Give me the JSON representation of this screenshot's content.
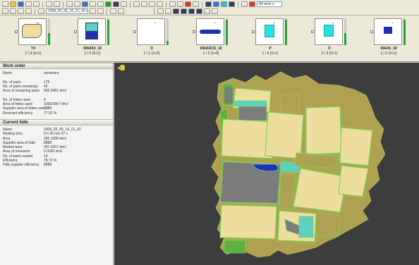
{
  "toolbar": {
    "file_combo": "2008_03_06_16_21_42.nb",
    "work_combo": "All work o"
  },
  "colors": {
    "hide": "#aea252",
    "part": "#eddea0",
    "part_edge": "#7ed35a",
    "green_part": "#5fb13f",
    "grey_part": "#7c7c7c",
    "cyan": "#5fd0c0",
    "blue_part": "#1d33b5",
    "canvas_bg": "#3d3d3d"
  },
  "thumbnails": [
    {
      "num": "76",
      "name": "T4",
      "count": "1 / 4 (0+1)",
      "shape": "cream-blob",
      "fill": 0.45
    },
    {
      "num": "30",
      "name": "666A53_18",
      "count": "1 / 2 (0+1)",
      "shape": "cyan-blue-box",
      "fill": 0.95
    },
    {
      "num": "1",
      "name": "D",
      "count": "1 / 1 (1+0)",
      "shape": "empty",
      "fill": 0.15
    },
    {
      "num": "1",
      "name": "666ADCS_18",
      "count": "1 / 2 (1+0)",
      "shape": "blue-bar",
      "fill": 0.95
    },
    {
      "num": "2",
      "name": "P",
      "count": "1 / 4 (0+1)",
      "shape": "cyan-box",
      "fill": 0.95
    },
    {
      "num": "1",
      "name": "O",
      "count": "2 / 4 (0+1)",
      "shape": "cyan-box-small",
      "fill": 0.45
    },
    {
      "num": "1",
      "name": "666A5_18",
      "count": "1 / 2 (0+1)",
      "shape": "blue-square",
      "fill": 0.95
    }
  ],
  "work_order": {
    "title": "Work order",
    "rows": [
      {
        "k": "Name",
        "v": "seminaire"
      },
      {
        "k": "",
        "v": ""
      },
      {
        "k": "No. of parts",
        "v": "175"
      },
      {
        "k": "No. of parts remaining",
        "v": "45"
      },
      {
        "k": "Area of remaining parts",
        "v": "583.0481 dm2"
      },
      {
        "k": "",
        "v": ""
      },
      {
        "k": "No. of hides used",
        "v": "8"
      },
      {
        "k": "Area of hides used",
        "v": "3068.5867 dm2"
      },
      {
        "k": "Supplier area of hides used",
        "v": "8888"
      },
      {
        "k": "Remnant efficiency",
        "v": "77.52 %"
      }
    ]
  },
  "current_hide": {
    "title": "Current hide",
    "rows": [
      {
        "k": "Name",
        "v": "2008_03_06_16_21_42"
      },
      {
        "k": "Nesting time",
        "v": "0 h 00 min 57 s"
      },
      {
        "k": "Area",
        "v": "365.1308 dm2"
      },
      {
        "k": "Supplier area of hide",
        "v": "8888"
      },
      {
        "k": "Nested area",
        "v": "287.4307 dm2"
      },
      {
        "k": "Area of remnants",
        "v": "0.0000 dm2"
      },
      {
        "k": "No. of parts nested",
        "v": "14"
      },
      {
        "k": "Efficiency",
        "v": "78.72 %"
      },
      {
        "k": "Hide supplier efficiency",
        "v": "8888"
      }
    ]
  }
}
